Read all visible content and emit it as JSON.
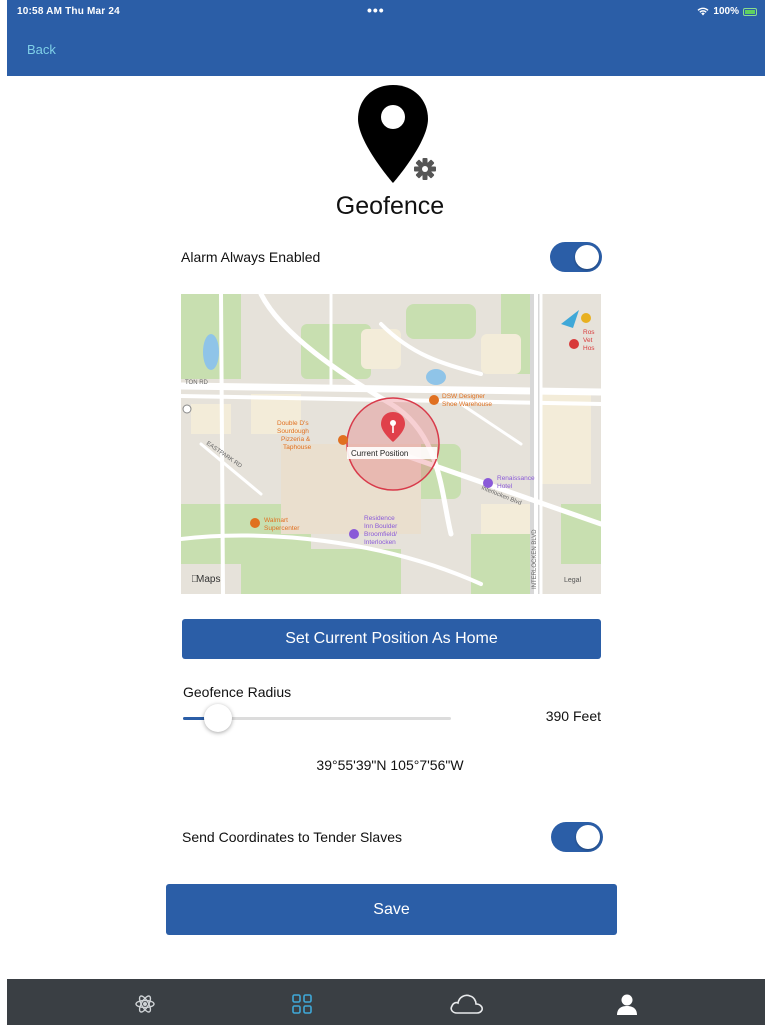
{
  "status_bar": {
    "time_date": "10:58 AM  Thu Mar 24",
    "center": "•••",
    "battery_text": "100%"
  },
  "nav": {
    "back_label": "Back"
  },
  "page": {
    "title": "Geofence",
    "logo_icon": "map-pin-gear-icon"
  },
  "alarm": {
    "label": "Alarm Always Enabled",
    "enabled": true
  },
  "map": {
    "attribution": "Maps",
    "legal": "Legal",
    "pin_label": "Current Position",
    "pois": [
      {
        "name_lines": [
          "Double D's",
          "Sourdough",
          "Pizzeria &",
          "Taphouse"
        ],
        "color": "#e07020"
      },
      {
        "name_lines": [
          "DSW Designer",
          "Shoe Warehouse"
        ],
        "color": "#e07020"
      },
      {
        "name_lines": [
          "Renaissance",
          "Hotel"
        ],
        "color": "#8a5ad8"
      },
      {
        "name_lines": [
          "Walmart",
          "Supercenter"
        ],
        "color": "#e07020"
      },
      {
        "name_lines": [
          "Residence",
          "Inn Boulder",
          "Broomfield/",
          "Interlocken"
        ],
        "color": "#8a5ad8"
      },
      {
        "name_lines": [
          "Ros",
          "Vet",
          "Hos"
        ],
        "color": "#d83a3a"
      }
    ],
    "street_labels": [
      "TON RD",
      "INTERLOCKEN BLVD",
      "Interlocken Blvd",
      "EASTPARK RD"
    ]
  },
  "home_button": {
    "label": "Set Current Position As Home"
  },
  "radius": {
    "label": "Geofence Radius",
    "value_text": "390 Feet",
    "slider_fraction": 0.13
  },
  "coordinates": {
    "text": "39°55'39\"N  105°7'56\"W"
  },
  "send_coords": {
    "label": "Send Coordinates to Tender Slaves",
    "enabled": true
  },
  "save_button": {
    "label": "Save"
  },
  "tabbar": {
    "tabs": [
      {
        "icon": "atom-icon",
        "active": false
      },
      {
        "icon": "grid-icon",
        "active": true
      },
      {
        "icon": "cloud-icon",
        "active": false
      },
      {
        "icon": "person-icon",
        "active": false
      }
    ]
  },
  "colors": {
    "primary": "#2b5ea7",
    "tabbar_bg": "#3a3f44",
    "active_tab": "#3fa8d8",
    "back_link": "#7fd0e8"
  }
}
